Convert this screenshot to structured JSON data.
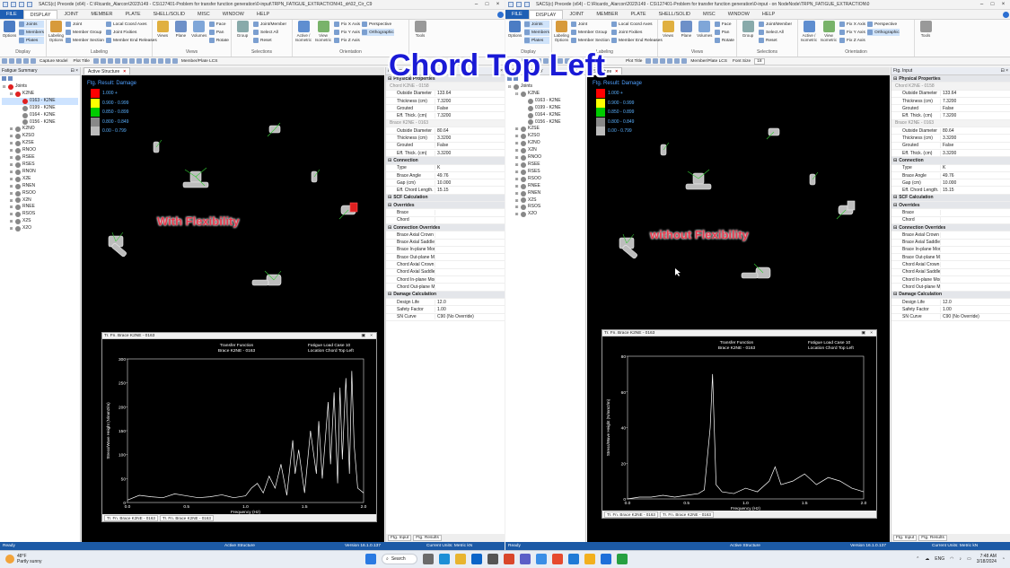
{
  "overlay_title": "Chord Top Left",
  "left": {
    "window_title": "SACS(c) Precede (x64) - C:\\Ricardo_Alarcon\\2023\\149 - CS\\127401-Problem for transfer function generation\\0-input\\TRPN_FATIGUE_EXTRACTION\\41_dr\\02_Cir_C9",
    "menu": [
      "FILE",
      "DISPLAY",
      "JOINT",
      "MEMBER",
      "PLATE",
      "SHELL/SOLID",
      "MISC",
      "WINDOW",
      "HELP"
    ],
    "active_menu": "DISPLAY",
    "ribbon": {
      "display_group": {
        "name": "Display",
        "options": "Options",
        "items": [
          "Joints",
          "Members",
          "Plates"
        ]
      },
      "labeling_group": {
        "name": "Labeling",
        "big": "Labeling Options",
        "items": [
          "Joint",
          "Member Group",
          "Member Section",
          "Local Coord Axes",
          "Joint Fixities",
          "Member End Releases"
        ]
      },
      "views_group": {
        "name": "Views",
        "items": [
          "Views",
          "Plane",
          "Volumes"
        ],
        "small": [
          "Face",
          "Pan",
          "Rotate"
        ]
      },
      "selections_group": {
        "name": "Selections",
        "big": "Group",
        "items": [
          "Joint/Member",
          "Select All",
          "Reset"
        ]
      },
      "orientation_group": {
        "name": "Orientation",
        "items": [
          "Active / Isometric",
          "View Isometric"
        ],
        "small": [
          "Fix X Axis",
          "Fix Y Axis",
          "Fix Z Axis",
          "Perspective",
          "Orthographic"
        ]
      },
      "tools": "Tools"
    },
    "toolbar2": [
      "Capture Model",
      "Plot Title",
      "Member/Plate LCS"
    ],
    "tree_panel_title": "Fatigue Summary",
    "tree": [
      {
        "label": "Joints",
        "level": 0,
        "exp": "⊟",
        "color": "#e02020"
      },
      {
        "label": "K2NE",
        "level": 1,
        "exp": "⊟",
        "color": "#e02020"
      },
      {
        "label": "0163 - K2NE",
        "level": 2,
        "exp": "",
        "color": "#e02020",
        "selected": true
      },
      {
        "label": "0199 - K2NE",
        "level": 2,
        "exp": "",
        "color": "#888888"
      },
      {
        "label": "0164 - K2NE",
        "level": 2,
        "exp": "",
        "color": "#888888"
      },
      {
        "label": "0156 - K2NE",
        "level": 2,
        "exp": "",
        "color": "#888888"
      },
      {
        "label": "K2NO",
        "level": 1,
        "exp": "⊞",
        "color": "#888888"
      },
      {
        "label": "K2SO",
        "level": 1,
        "exp": "⊞",
        "color": "#888888"
      },
      {
        "label": "K2SE",
        "level": 1,
        "exp": "⊞",
        "color": "#888888"
      },
      {
        "label": "RNOO",
        "level": 1,
        "exp": "⊞",
        "color": "#888888"
      },
      {
        "label": "RSEE",
        "level": 1,
        "exp": "⊞",
        "color": "#888888"
      },
      {
        "label": "RSES",
        "level": 1,
        "exp": "⊞",
        "color": "#888888"
      },
      {
        "label": "RNON",
        "level": 1,
        "exp": "⊞",
        "color": "#888888"
      },
      {
        "label": "X2E",
        "level": 1,
        "exp": "⊞",
        "color": "#888888"
      },
      {
        "label": "RNEN",
        "level": 1,
        "exp": "⊞",
        "color": "#888888"
      },
      {
        "label": "RSOO",
        "level": 1,
        "exp": "⊞",
        "color": "#888888"
      },
      {
        "label": "X2N",
        "level": 1,
        "exp": "⊞",
        "color": "#888888"
      },
      {
        "label": "RNEE",
        "level": 1,
        "exp": "⊞",
        "color": "#888888"
      },
      {
        "label": "RSOS",
        "level": 1,
        "exp": "⊞",
        "color": "#888888"
      },
      {
        "label": "X2S",
        "level": 1,
        "exp": "⊞",
        "color": "#888888"
      },
      {
        "label": "X2O",
        "level": 1,
        "exp": "⊞",
        "color": "#888888"
      }
    ],
    "viewport_tab": "Active Structure",
    "legend_title": "Ftg. Result: Damage",
    "legend": [
      {
        "label": "1.000 +",
        "color": "#ff0000"
      },
      {
        "label": "0.900 - 0.999",
        "color": "#ffff00"
      },
      {
        "label": "0.850 - 0.899",
        "color": "#00cc00"
      },
      {
        "label": "0.800 - 0.849",
        "color": "#888888"
      },
      {
        "label": "0.00 - 0.799",
        "color": "#bbbbbb"
      }
    ],
    "annotation": "With Flexibility",
    "plot": {
      "window_title": "Tr. Fn. Brace K2NE - 0163",
      "header_left": [
        "Transfer Function",
        "Brace K2NE - 0163"
      ],
      "header_right": [
        "Fatigue Load Case     10",
        "Location   Chord Top Left"
      ],
      "ylabel": "Stress/Wave Height (N/mm2/m)",
      "xlabel": "Frequency  (Hz)",
      "tabs": [
        "Tr. Fn. Brace K2NE - 0163",
        "Tr. Fn. Brace K2NE - 0163"
      ]
    },
    "props_title": "Ftg. Input",
    "props_tabs": [
      "Ftg. Input",
      "Ftg. Results"
    ],
    "status": {
      "left": "Ready",
      "center": "Active Structure",
      "version": "Version 16.1.0.137",
      "units": "Current Units: Metric kN"
    }
  },
  "right": {
    "window_title": "SACS(c) Precede (x64) - C:\\Ricardo_Alarcon\\2023\\149 - CS\\127401-Problem for transfer function generation\\0-input - on NodeNode\\TRPN_FATIGUE_EXTRACTION\\0",
    "menu": [
      "FILE",
      "DISPLAY",
      "JOINT",
      "MEMBER",
      "PLATE",
      "SHELL/SOLID",
      "MISC",
      "WINDOW",
      "HELP"
    ],
    "active_menu": "DISPLAY",
    "toolbar2": [
      "Plot Title",
      "Member/Plate LCS",
      "Font Size",
      "18"
    ],
    "tree": [
      {
        "label": "Joints",
        "level": 0,
        "exp": "⊟",
        "color": "#888888"
      },
      {
        "label": "K2NE",
        "level": 1,
        "exp": "⊟",
        "color": "#888888"
      },
      {
        "label": "0163 - K2NE",
        "level": 2,
        "exp": "",
        "color": "#888888"
      },
      {
        "label": "0199 - K2NE",
        "level": 2,
        "exp": "",
        "color": "#888888"
      },
      {
        "label": "0164 - K2NE",
        "level": 2,
        "exp": "",
        "color": "#888888"
      },
      {
        "label": "0156 - K2NE",
        "level": 2,
        "exp": "",
        "color": "#888888"
      },
      {
        "label": "K2SE",
        "level": 1,
        "exp": "⊞",
        "color": "#888888"
      },
      {
        "label": "K2SO",
        "level": 1,
        "exp": "⊞",
        "color": "#888888"
      },
      {
        "label": "K2NO",
        "level": 1,
        "exp": "⊞",
        "color": "#888888"
      },
      {
        "label": "X2N",
        "level": 1,
        "exp": "⊞",
        "color": "#888888"
      },
      {
        "label": "RNOO",
        "level": 1,
        "exp": "⊞",
        "color": "#888888"
      },
      {
        "label": "RSEE",
        "level": 1,
        "exp": "⊞",
        "color": "#888888"
      },
      {
        "label": "RSES",
        "level": 1,
        "exp": "⊞",
        "color": "#888888"
      },
      {
        "label": "RSOO",
        "level": 1,
        "exp": "⊞",
        "color": "#888888"
      },
      {
        "label": "RNEE",
        "level": 1,
        "exp": "⊞",
        "color": "#888888"
      },
      {
        "label": "RNEN",
        "level": 1,
        "exp": "⊞",
        "color": "#888888"
      },
      {
        "label": "X2S",
        "level": 1,
        "exp": "⊞",
        "color": "#888888"
      },
      {
        "label": "RSOS",
        "level": 1,
        "exp": "⊞",
        "color": "#888888"
      },
      {
        "label": "X2O",
        "level": 1,
        "exp": "⊞",
        "color": "#888888"
      }
    ],
    "viewport_tab": "Structure",
    "legend_title": "Ftg. Result: Damage",
    "legend": [
      {
        "label": "1.000 +",
        "color": "#ff0000"
      },
      {
        "label": "0.900 - 0.999",
        "color": "#ffff00"
      },
      {
        "label": "0.850 - 0.899",
        "color": "#00cc00"
      },
      {
        "label": "0.800 - 0.849",
        "color": "#888888"
      },
      {
        "label": "0.00 - 0.799",
        "color": "#bbbbbb"
      }
    ],
    "annotation": "without Flexibility",
    "plot": {
      "window_title": "Tr. Fn. Brace K2NE - 0163",
      "header_left": [
        "Transfer Function",
        "Brace K2NE - 0163"
      ],
      "header_right": [
        "Fatigue Load Case     10",
        "Location   Chord Top Left"
      ],
      "ylabel": "Stress/Wave Height (N/mm2/m)",
      "xlabel": "Frequency  (Hz)",
      "tabs": [
        "Tr. Fn. Brace K2NE - 0163",
        "Tr. Fn. Brace K2NE - 0163"
      ]
    },
    "props_title": "Ftg. Input",
    "props_tabs": [
      "Ftg. Input",
      "Ftg. Results"
    ],
    "status": {
      "left": "Ready",
      "center": "Active Structure",
      "version": "Version 16.1.0.137",
      "units": "Current Units: Metric kN"
    }
  },
  "properties": [
    {
      "type": "sec",
      "k": "Physical Properties"
    },
    {
      "type": "sub",
      "k": "Chord K2NE - 0158"
    },
    {
      "k": "Outside Diameter",
      "v": "133.64"
    },
    {
      "k": "Thickness (cm)",
      "v": "7.3200"
    },
    {
      "k": "Grouted",
      "v": "False"
    },
    {
      "k": "Eff. Thick. (cm)",
      "v": "7.3200"
    },
    {
      "type": "sub",
      "k": "Brace K2NE - 0163"
    },
    {
      "k": "Outside Diameter",
      "v": "80.64"
    },
    {
      "k": "Thickness (cm)",
      "v": "3.3200"
    },
    {
      "k": "Grouted",
      "v": "False"
    },
    {
      "k": "Eff. Thick. (cm)",
      "v": "3.3200"
    },
    {
      "type": "sec",
      "k": "Connection"
    },
    {
      "k": "Type",
      "v": "K"
    },
    {
      "k": "Brace Angle",
      "v": "49.76"
    },
    {
      "k": "Gap (cm)",
      "v": "10.000"
    },
    {
      "k": "Eff. Chord Length. (m)",
      "v": "15.15"
    },
    {
      "type": "sec",
      "k": "SCF Calculation"
    },
    {
      "type": "sec",
      "k": "Overrides"
    },
    {
      "k": "Brace",
      "v": ""
    },
    {
      "k": "Chord",
      "v": ""
    },
    {
      "type": "sec",
      "k": "Connection Overrides"
    },
    {
      "k": "Brace Axial Crown",
      "v": ""
    },
    {
      "k": "Brace Axial Saddle",
      "v": ""
    },
    {
      "k": "Brace In-plane Mome",
      "v": ""
    },
    {
      "k": "Brace Out-plane Mor",
      "v": ""
    },
    {
      "k": "Chord Axial Crown",
      "v": ""
    },
    {
      "k": "Chord Axial Saddle",
      "v": ""
    },
    {
      "k": "Chord In-plane Mome",
      "v": ""
    },
    {
      "k": "Chord Out-plane Mor",
      "v": ""
    },
    {
      "type": "sec",
      "k": "Damage Calculation"
    },
    {
      "k": "Design Life",
      "v": "12.0"
    },
    {
      "k": "Safety Factor",
      "v": "1.00"
    },
    {
      "k": "SN Curve",
      "v": "C90 (No Override)"
    }
  ],
  "chart_data": [
    {
      "type": "line",
      "title": "Transfer Function Brace K2NE - 0163",
      "xlabel": "Frequency  (Hz)",
      "ylabel": "Stress/Wave Height (N/mm2/m)",
      "xlim": [
        0.0,
        2.0
      ],
      "ylim": [
        0,
        300
      ],
      "xticks": [
        "0.0",
        "0.5",
        "1.0",
        "1.5",
        "2.0"
      ],
      "yticks": [
        "0",
        "50",
        "100",
        "150",
        "200",
        "250",
        "300"
      ],
      "series": [
        {
          "x": [
            0.0,
            0.1,
            0.2,
            0.3,
            0.4,
            0.5,
            0.6,
            0.7,
            0.8,
            0.9,
            1.0,
            1.05,
            1.1,
            1.15,
            1.2,
            1.25,
            1.3,
            1.35,
            1.4,
            1.42,
            1.45,
            1.5,
            1.55,
            1.6,
            1.62,
            1.65,
            1.7,
            1.72,
            1.75,
            1.78,
            1.8,
            1.82,
            1.85,
            1.88,
            1.9,
            1.92,
            1.95,
            2.0
          ],
          "y": [
            5,
            15,
            12,
            10,
            18,
            14,
            10,
            12,
            16,
            10,
            14,
            30,
            40,
            20,
            55,
            30,
            80,
            15,
            130,
            60,
            110,
            20,
            150,
            60,
            170,
            50,
            210,
            80,
            230,
            40,
            240,
            90,
            260,
            60,
            275,
            120,
            30,
            20
          ]
        }
      ]
    },
    {
      "type": "line",
      "title": "Transfer Function Brace K2NE - 0163",
      "xlabel": "Frequency  (Hz)",
      "ylabel": "Stress/Wave Height (N/mm2/m)",
      "xlim": [
        0.0,
        2.0
      ],
      "ylim": [
        0,
        80
      ],
      "xticks": [
        "0.0",
        "0.5",
        "1.0",
        "1.5",
        "2.0"
      ],
      "yticks": [
        "0",
        "20",
        "40",
        "60",
        "80"
      ],
      "series": [
        {
          "x": [
            0.0,
            0.1,
            0.2,
            0.3,
            0.4,
            0.5,
            0.6,
            0.65,
            0.7,
            0.72,
            0.75,
            0.8,
            0.9,
            1.0,
            1.1,
            1.2,
            1.25,
            1.3,
            1.4,
            1.5,
            1.6,
            1.7,
            1.8,
            1.9,
            2.0
          ],
          "y": [
            0,
            1,
            1,
            2,
            1,
            2,
            3,
            5,
            40,
            70,
            8,
            4,
            3,
            6,
            4,
            10,
            18,
            8,
            10,
            14,
            8,
            12,
            10,
            6,
            4
          ]
        }
      ]
    }
  ],
  "taskbar": {
    "weather_temp": "48°F",
    "weather_desc": "Partly sunny",
    "search": "Search",
    "lang": "ENG",
    "time": "7:48 AM",
    "date": "3/18/2024"
  }
}
